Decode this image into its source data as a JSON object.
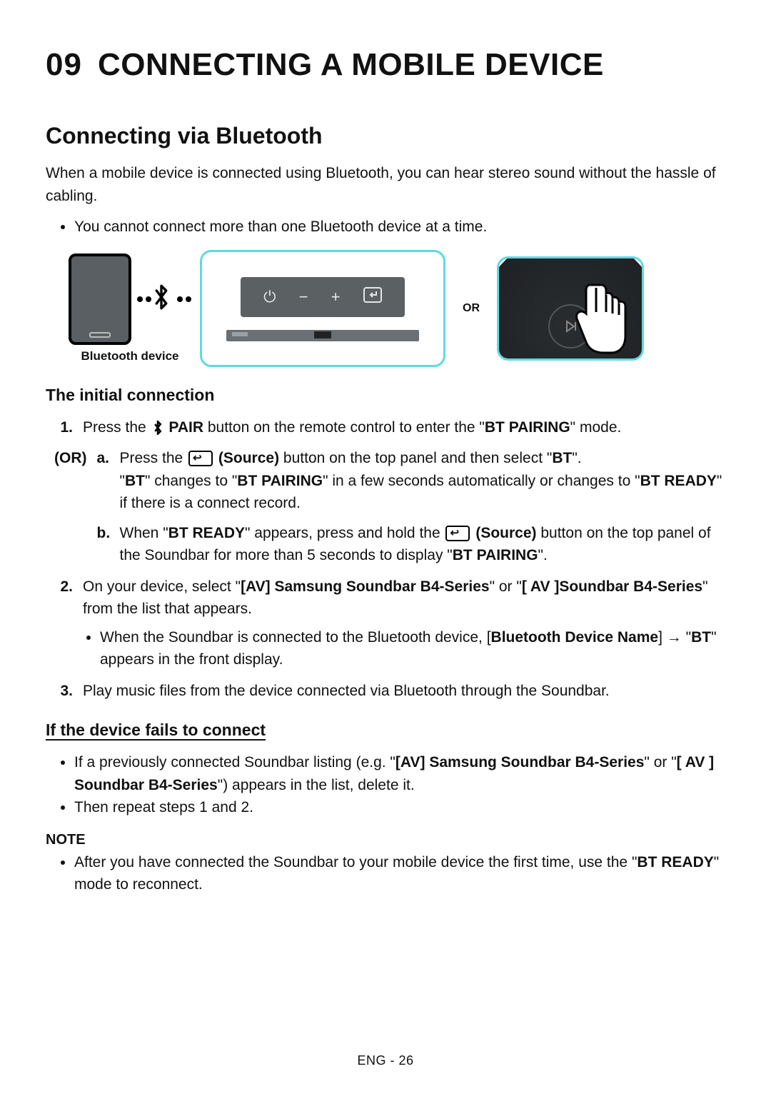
{
  "chapter": {
    "number": "09",
    "title": "CONNECTING A MOBILE DEVICE"
  },
  "section_title": "Connecting via Bluetooth",
  "intro": "When a mobile device is connected using Bluetooth, you can hear stereo sound without the hassle of cabling.",
  "top_bullet": "You cannot connect more than one Bluetooth device at a time.",
  "illus": {
    "bt_label": "Bluetooth device",
    "or": "OR"
  },
  "sub_initial": "The initial connection",
  "labels": {
    "or_marker": "(OR)",
    "pair": "PAIR",
    "source": "(Source)",
    "arrow": " → ",
    "note": "NOTE"
  },
  "step1": {
    "num": "1.",
    "t1": "Press the ",
    "t2": " button on the remote control to enter the \"",
    "b1": "BT PAIRING",
    "t3": "\" mode."
  },
  "or_a": {
    "label": "a.",
    "t1": "Press the ",
    "t2": " button on the top panel and then select \"",
    "b1": "BT",
    "t3": "\".",
    "line2_pre": "\"",
    "b2": "BT",
    "t4": "\" changes to \"",
    "b3": "BT PAIRING",
    "t5": "\" in a few seconds automatically or changes to \"",
    "b4": "BT READY",
    "t6": "\" if there is a connect record."
  },
  "or_b": {
    "label": "b.",
    "t1": "When \"",
    "b1": "BT READY",
    "t2": "\" appears, press and hold the ",
    "t3": " button on the top panel of the Soundbar for more than 5 seconds to display \"",
    "b2": "BT PAIRING",
    "t4": "\"."
  },
  "step2": {
    "num": "2.",
    "t1": "On your device, select \"",
    "b1": "[AV] Samsung Soundbar B4-Series",
    "t2": "\" or \"",
    "b2": "[ AV ]Soundbar B4-Series",
    "t3": "\" from the list that appears.",
    "bullet_t1": "When the Soundbar is connected to the Bluetooth device, [",
    "bullet_b1": "Bluetooth Device Name",
    "bullet_t2": "]",
    "bullet_t3": "\"",
    "bullet_b2": "BT",
    "bullet_t4": "\" appears in the front display."
  },
  "step3": {
    "num": "3.",
    "text": "Play music files from the device connected via Bluetooth through the Soundbar."
  },
  "sub_fails": "If the device fails to connect",
  "fails": {
    "li1_t1": "If a previously connected Soundbar listing (e.g. \"",
    "li1_b1": "[AV] Samsung Soundbar B4-Series",
    "li1_t2": "\" or \"",
    "li1_b2": "[ AV ] Soundbar B4-Series",
    "li1_t3": "\") appears in the list, delete it.",
    "li2": "Then repeat steps 1 and 2."
  },
  "note": {
    "t1": "After you have connected the Soundbar to your mobile device the first time, use the \"",
    "b1": "BT READY",
    "t2": "\" mode to reconnect."
  },
  "footer": "ENG - 26"
}
